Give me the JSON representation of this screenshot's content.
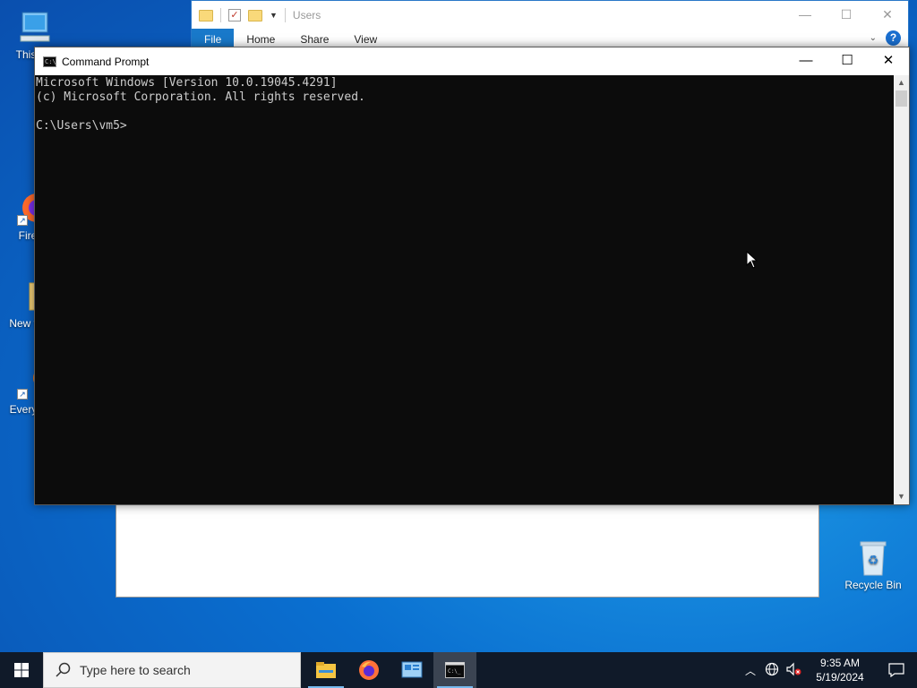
{
  "desktop": {
    "icons": [
      {
        "label": "This PC",
        "icon": "computer-icon"
      },
      {
        "label": "Firefox",
        "icon": "firefox-icon"
      },
      {
        "label": "New folder",
        "icon": "folder-icon"
      },
      {
        "label": "Everything",
        "icon": "search-app-icon"
      },
      {
        "label": "Recycle Bin",
        "icon": "recycle-bin-icon"
      }
    ]
  },
  "explorer": {
    "title": "Users",
    "tabs": [
      "File",
      "Home",
      "Share",
      "View"
    ],
    "help": "?"
  },
  "cmd": {
    "title": "Command Prompt",
    "lines": [
      "Microsoft Windows [Version 10.0.19045.4291]",
      "(c) Microsoft Corporation. All rights reserved.",
      "",
      "C:\\Users\\vm5>"
    ]
  },
  "taskbar": {
    "search_placeholder": "Type here to search",
    "apps": [
      "file-explorer-icon",
      "firefox-icon",
      "control-panel-icon",
      "command-prompt-icon"
    ],
    "active_app": "command-prompt-icon",
    "clock": {
      "time": "9:35 AM",
      "date": "5/19/2024"
    }
  },
  "colors": {
    "accent": "#1979ca",
    "console_bg": "#0c0c0c",
    "console_fg": "#cccccc",
    "taskbar": "#101a29"
  }
}
